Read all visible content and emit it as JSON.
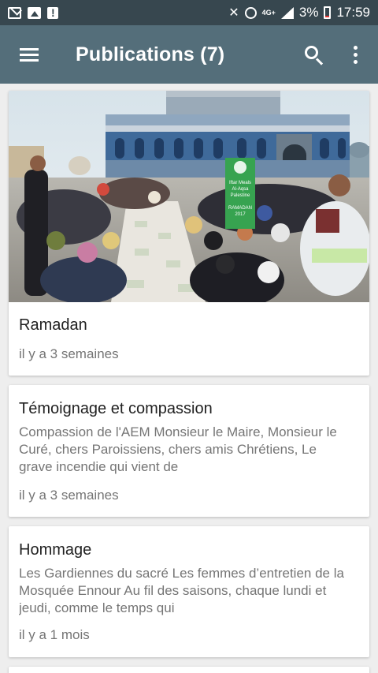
{
  "status_bar": {
    "network": "4G+",
    "battery": "3%",
    "time": "17:59"
  },
  "app_bar": {
    "title": "Publications (7)"
  },
  "publications": [
    {
      "title": "Ramadan",
      "excerpt": "",
      "time_ago": "il y a 3 semaines",
      "banner_text": [
        "Iftar Meals",
        "Al-Aqsa",
        "Palestine",
        "RAMADAN",
        "2017"
      ]
    },
    {
      "title": "Témoignage et compassion",
      "excerpt": "Compassion de l'AEM                         Monsieur le Maire, Monsieur le Curé, chers Paroissiens, chers amis Chrétiens,     Le grave incendie qui vient de",
      "time_ago": "il y a 3 semaines"
    },
    {
      "title": "Hommage",
      "excerpt": "Les Gardiennes du sacré                        Les femmes d’entretien de la Mosquée Ennour Au fil des saisons, chaque  lundi et jeudi, comme le temps qui",
      "time_ago": "il y a 1 mois"
    }
  ]
}
